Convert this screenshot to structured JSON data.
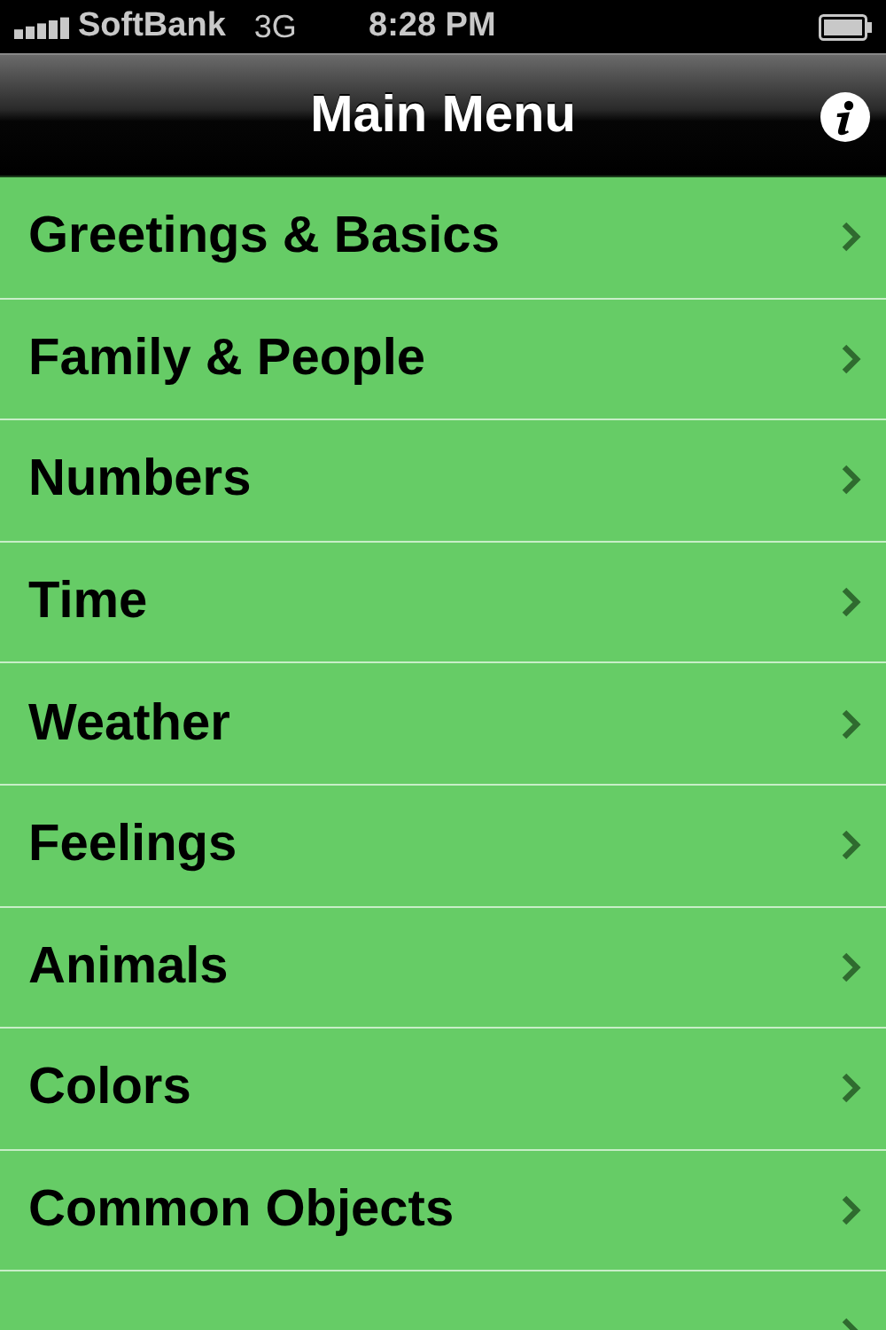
{
  "status_bar": {
    "carrier": "SoftBank",
    "network": "3G",
    "time": "8:28 PM"
  },
  "nav_bar": {
    "title": "Main Menu"
  },
  "menu_items": [
    {
      "label": "Greetings & Basics"
    },
    {
      "label": "Family & People"
    },
    {
      "label": "Numbers"
    },
    {
      "label": "Time"
    },
    {
      "label": "Weather"
    },
    {
      "label": "Feelings"
    },
    {
      "label": "Animals"
    },
    {
      "label": "Colors"
    },
    {
      "label": "Common Objects"
    }
  ],
  "cut_off_row": true
}
